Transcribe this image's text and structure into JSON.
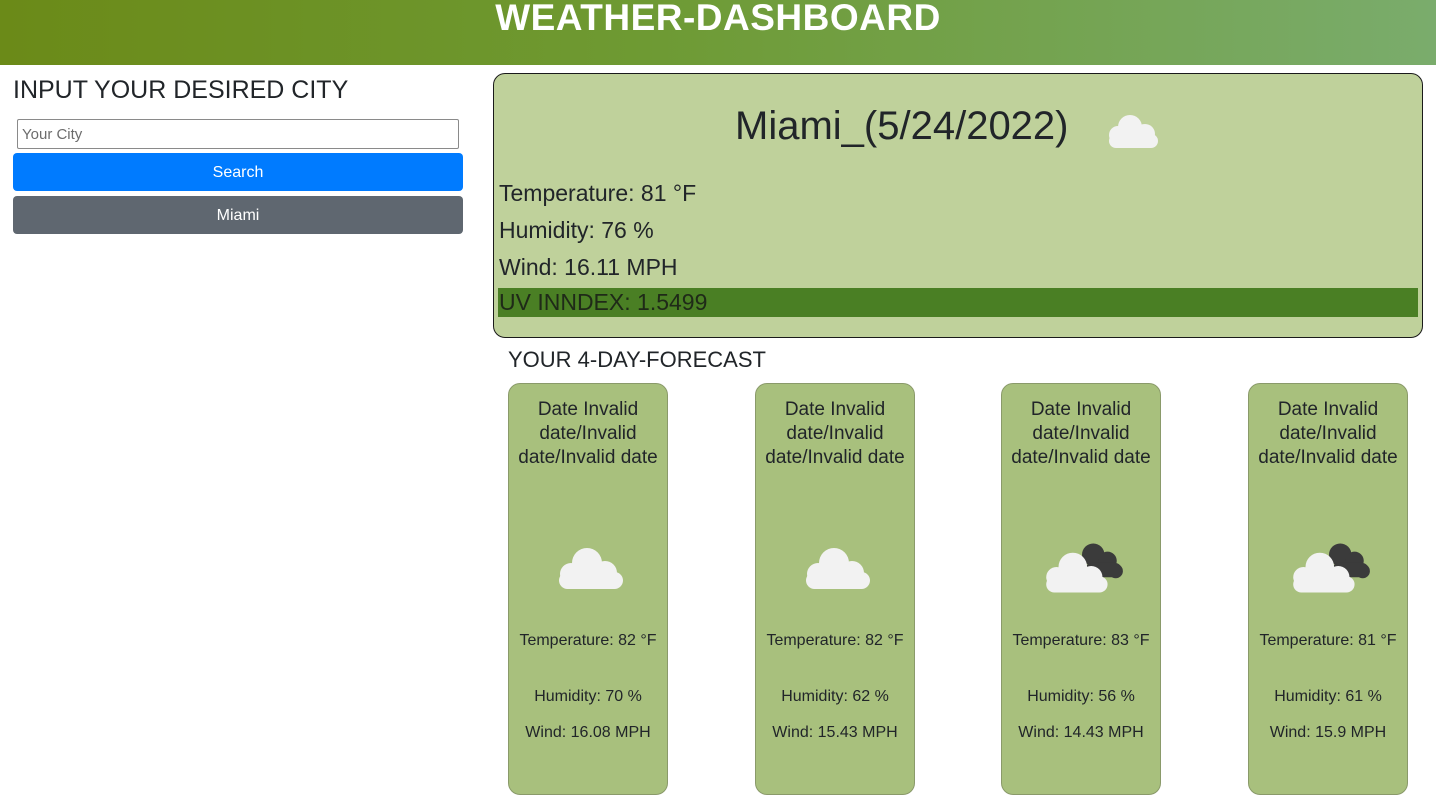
{
  "header": {
    "title": "WEATHER-DASHBOARD"
  },
  "sidebar": {
    "heading": "INPUT YOUR DESIRED CITY",
    "search_input": {
      "value": "",
      "placeholder": "Your City"
    },
    "search_button_label": "Search",
    "history": [
      {
        "label": "Miami"
      }
    ]
  },
  "current": {
    "title": "Miami_(5/24/2022)",
    "icon": "cloud-icon",
    "temperature": "Temperature: 81 °F",
    "humidity": "Humidity: 76 %",
    "wind": "Wind: 16.11 MPH",
    "uv_index": "UV INNDEX: 1.5499"
  },
  "forecast": {
    "heading": "YOUR 4-DAY-FORECAST",
    "days": [
      {
        "date": "Date Invalid date/Invalid date/Invalid date",
        "icon": "cloud-icon",
        "temperature": "Temperature: 82 °F",
        "humidity": "Humidity: 70 %",
        "wind": "Wind: 16.08 MPH"
      },
      {
        "date": "Date Invalid date/Invalid date/Invalid date",
        "icon": "cloud-icon",
        "temperature": "Temperature: 82 °F",
        "humidity": "Humidity: 62 %",
        "wind": "Wind: 15.43 MPH"
      },
      {
        "date": "Date Invalid date/Invalid date/Invalid date",
        "icon": "broken-clouds-icon",
        "temperature": "Temperature: 83 °F",
        "humidity": "Humidity: 56 %",
        "wind": "Wind: 14.43 MPH"
      },
      {
        "date": "Date Invalid date/Invalid date/Invalid date",
        "icon": "broken-clouds-icon",
        "temperature": "Temperature: 81 °F",
        "humidity": "Humidity: 61 %",
        "wind": "Wind: 15.9 MPH"
      }
    ]
  },
  "colors": {
    "header_gradient_start": "#6b8a18",
    "header_gradient_end": "#7aac6c",
    "search_button": "#007bff",
    "history_button": "#5f6770",
    "current_card_bg": "#bfd19b",
    "uv_bar": "#4a7f24",
    "forecast_card_bg": "#a8c07d"
  }
}
